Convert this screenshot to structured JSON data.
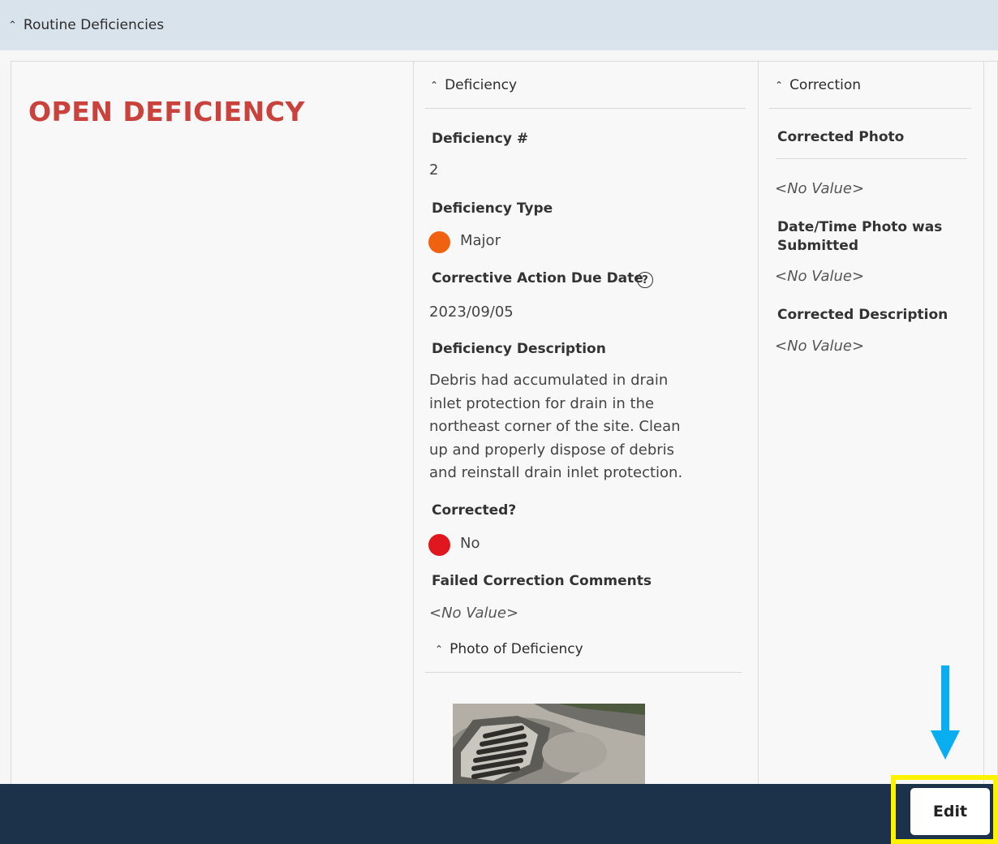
{
  "header": {
    "title": "Routine Deficiencies"
  },
  "status_title": "OPEN DEFICIENCY",
  "deficiency": {
    "section_title": "Deficiency",
    "number_label": "Deficiency #",
    "number_value": "2",
    "type_label": "Deficiency Type",
    "type_value": "Major",
    "type_color": "#f0620f",
    "due_label": "Corrective Action Due Date",
    "due_value": "2023/09/05",
    "description_label": "Deficiency Description",
    "description_lines": [
      "Debris had accumulated in drain",
      "inlet protection for drain in the",
      "northeast corner of the site. Clean",
      "up and properly dispose of debris",
      "and reinstall drain inlet protection."
    ],
    "corrected_label": "Corrected?",
    "corrected_value": "No",
    "corrected_color": "#e0171f",
    "failed_label": "Failed Correction Comments",
    "failed_value": "<No Value>",
    "photo_section_title": "Photo of Deficiency"
  },
  "correction": {
    "section_title": "Correction",
    "photo_label": "Corrected Photo",
    "photo_value": "<No Value>",
    "datetime_label_line1": "Date/Time Photo was",
    "datetime_label_line2": "Submitted",
    "datetime_value": "<No Value>",
    "description_label": "Corrected Description",
    "description_value": "<No Value>"
  },
  "footer": {
    "edit_label": "Edit"
  },
  "colors": {
    "accent_title": "#c9423c",
    "footer_bg": "#1c324a",
    "highlight": "#fff200",
    "arrow": "#09aef0"
  }
}
